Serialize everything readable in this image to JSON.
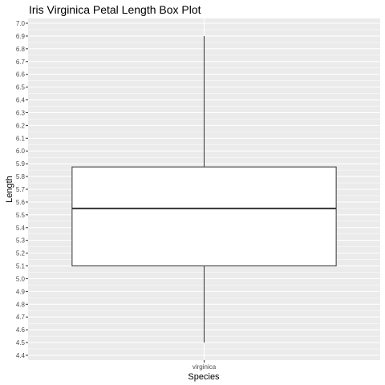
{
  "chart_data": {
    "type": "box",
    "title": "Iris Virginica Petal Length Box Plot",
    "xlabel": "Species",
    "ylabel": "Length",
    "categories": [
      "virginica"
    ],
    "ylim": [
      4.4,
      7.0
    ],
    "yticks": [
      "4.4",
      "4.5",
      "4.6",
      "4.7",
      "4.8",
      "4.9",
      "5.0",
      "5.1",
      "5.2",
      "5.3",
      "5.4",
      "5.5",
      "5.6",
      "5.7",
      "5.8",
      "5.9",
      "6.0",
      "6.1",
      "6.2",
      "6.3",
      "6.4",
      "6.5",
      "6.6",
      "6.7",
      "6.8",
      "6.9",
      "7.0"
    ],
    "boxes": [
      {
        "category": "virginica",
        "min": 4.5,
        "q1": 5.1,
        "median": 5.55,
        "q3": 5.875,
        "max": 6.9
      }
    ],
    "grid": true,
    "colors": {
      "panel": "#ebebeb",
      "grid": "#ffffff",
      "box_fill": "#ffffff",
      "box_stroke": "#333333"
    }
  }
}
